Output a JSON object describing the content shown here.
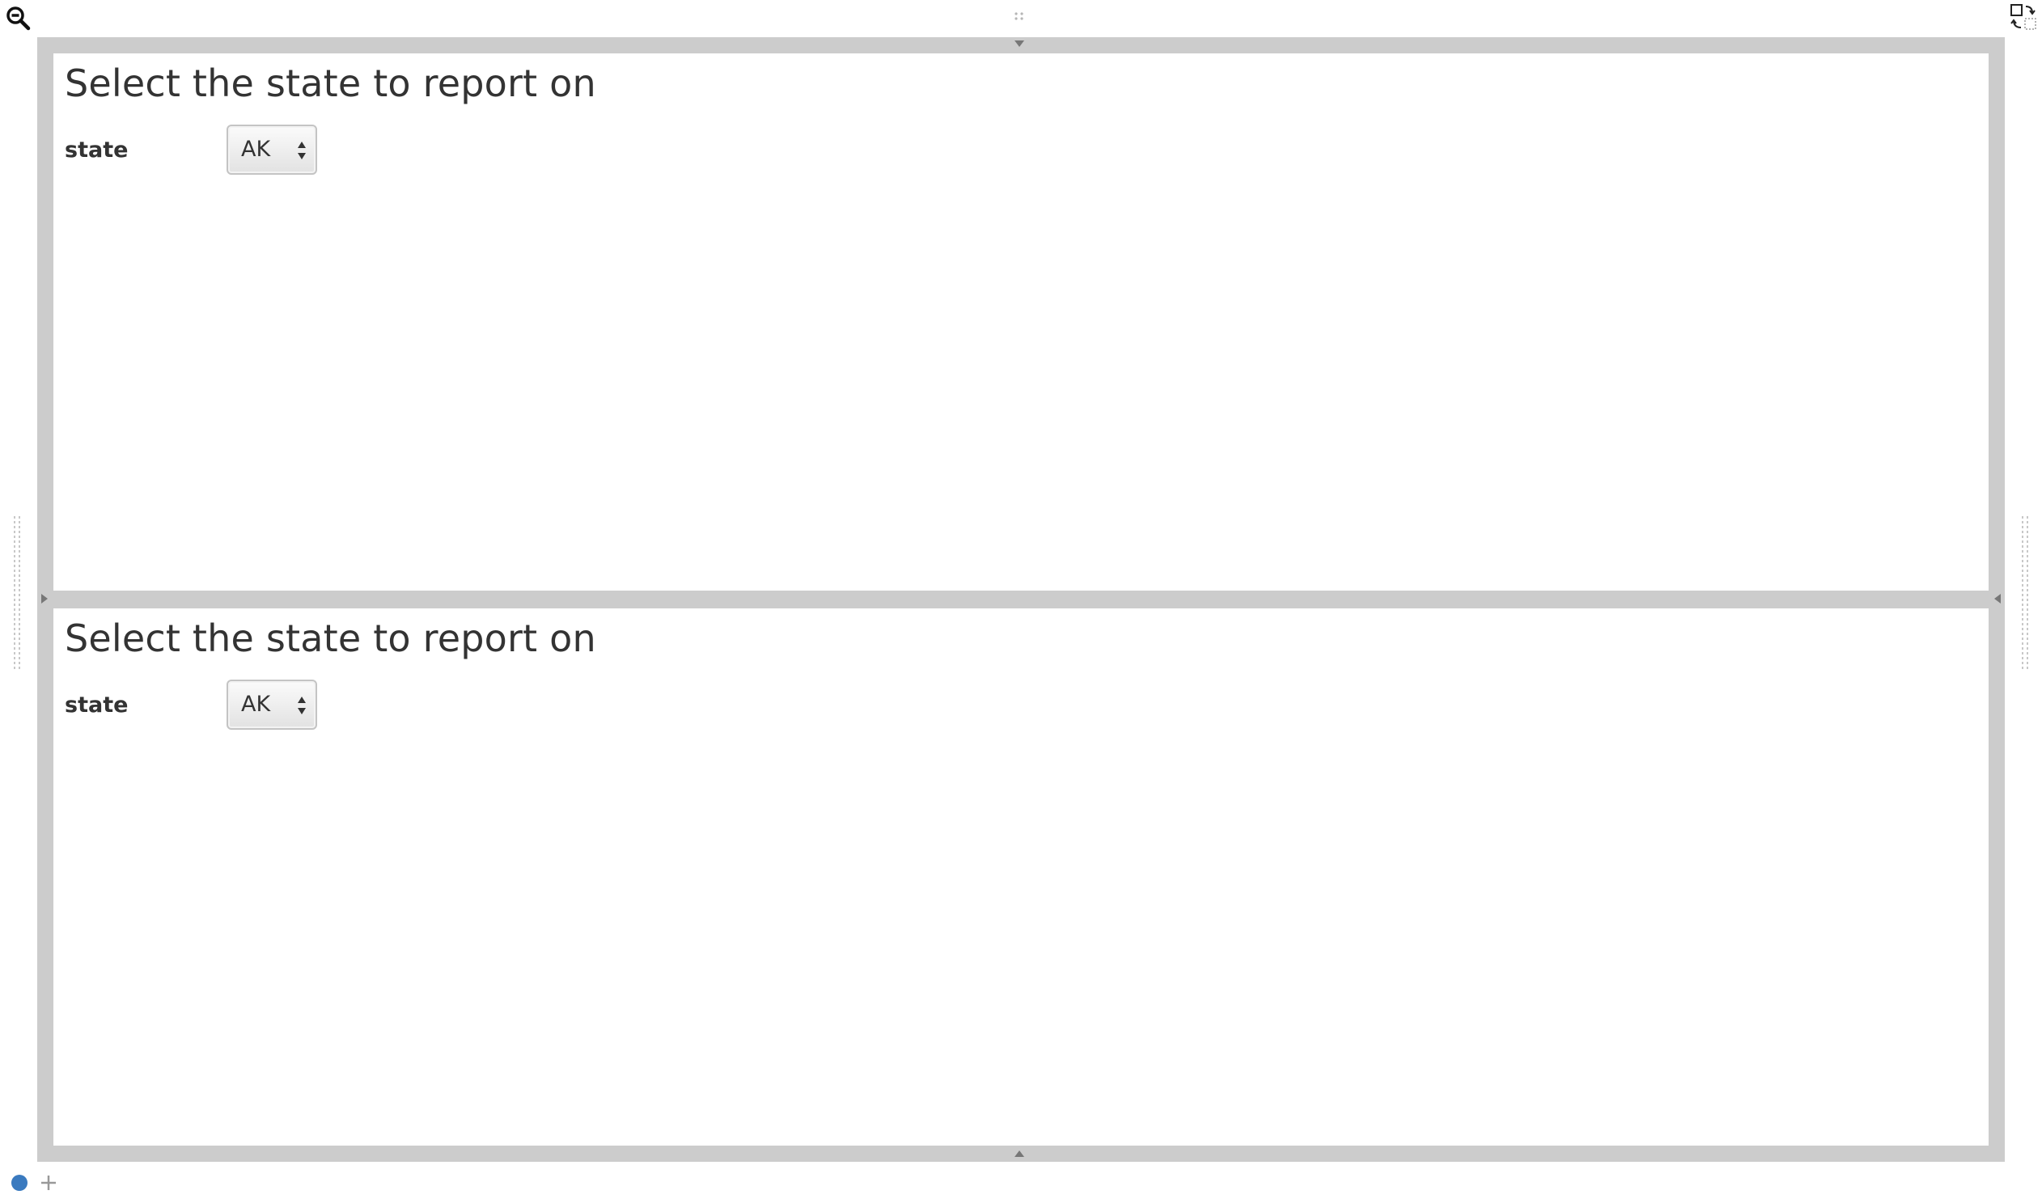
{
  "toolbar": {
    "zoom_icon": "zoom-out-icon",
    "layout_icon": "layout-toggle-icon"
  },
  "panels": [
    {
      "title": "Select the state to report on",
      "field_label": "state",
      "select_value": "AK"
    },
    {
      "title": "Select the state to report on",
      "field_label": "state",
      "select_value": "AK"
    }
  ],
  "pages": {
    "active_color": "#3a7abf",
    "add_icon": "plus-icon"
  },
  "colors": {
    "frame": "#cccccc",
    "panel": "#ffffff",
    "text": "#333333"
  }
}
